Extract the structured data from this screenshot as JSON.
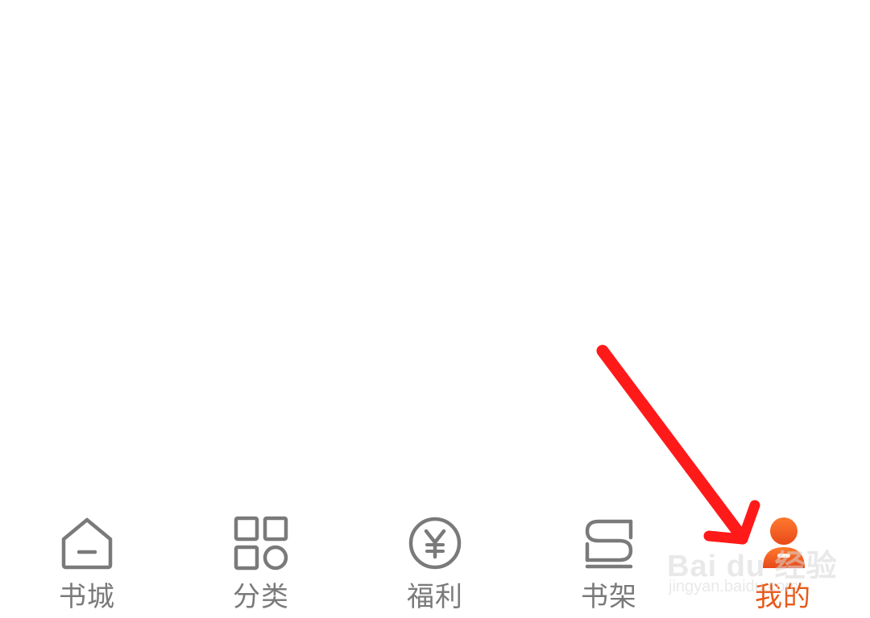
{
  "tab_bar": {
    "active": "mine",
    "accent_color": "#e8591a",
    "inactive_color": "#7a7a7a",
    "items": [
      {
        "id": "bookstore",
        "label": "书城",
        "icon": "home-icon"
      },
      {
        "id": "category",
        "label": "分类",
        "icon": "grid-icon"
      },
      {
        "id": "welfare",
        "label": "福利",
        "icon": "yen-coin-icon"
      },
      {
        "id": "bookshelf",
        "label": "书架",
        "icon": "bookshelf-icon"
      },
      {
        "id": "mine",
        "label": "我的",
        "icon": "user-icon"
      }
    ]
  },
  "annotation": {
    "arrow_color": "#ff1a1a"
  },
  "watermark": {
    "brand": "Bai du 经验",
    "url": "jingyan.baidu.com"
  }
}
